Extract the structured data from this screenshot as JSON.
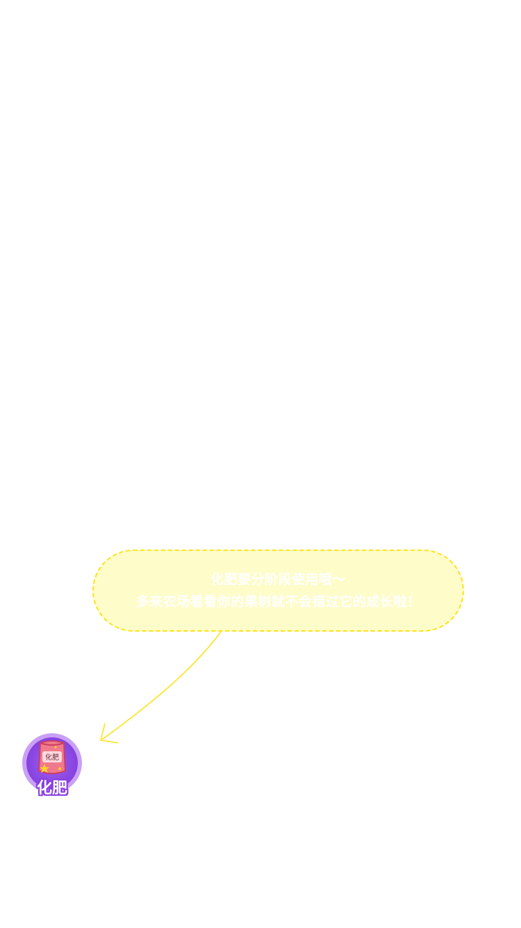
{
  "tip": {
    "line1": "化肥要分阶段使用哦～",
    "line2": "多来农场看看你的果树就不会错过它的成长啦！"
  },
  "fertilizer": {
    "label": "化肥",
    "bag_text": "化肥",
    "icon": "fertilizer-bag-icon"
  },
  "colors": {
    "bubble_fill": "#fefcc9",
    "bubble_border": "#ffe21a",
    "arrow": "#ffe21a",
    "button_purple": "#8a46e2"
  }
}
